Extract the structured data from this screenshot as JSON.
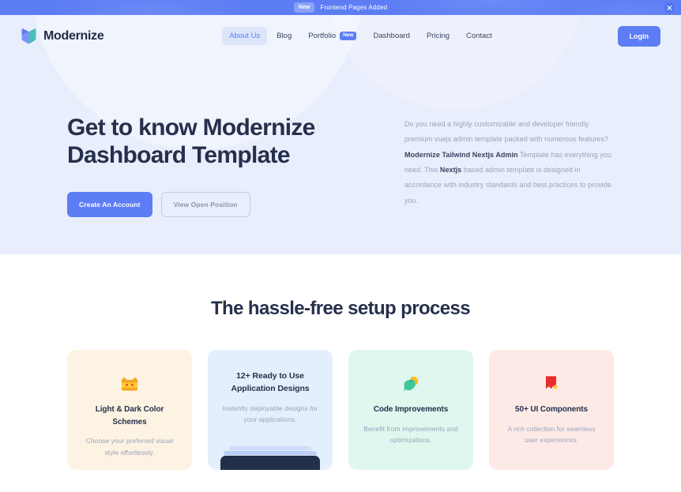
{
  "banner": {
    "badge": "New",
    "text": "Frontend Pages Added",
    "close_icon": "close-icon",
    "bg_color": "#5d7df5"
  },
  "navbar": {
    "brand": {
      "name": "Modernize",
      "logo_icon": "modernize-logo-icon"
    },
    "items": [
      {
        "label": "About Us",
        "active": true,
        "badge": null
      },
      {
        "label": "Blog",
        "active": false,
        "badge": null
      },
      {
        "label": "Portfolio",
        "active": false,
        "badge": "New"
      },
      {
        "label": "Dashboard",
        "active": false,
        "badge": null
      },
      {
        "label": "Pricing",
        "active": false,
        "badge": null
      },
      {
        "label": "Contact",
        "active": false,
        "badge": null
      }
    ],
    "login_label": "Login",
    "accent_color": "#5d7df5",
    "active_pill_color": "#dde5fb"
  },
  "hero": {
    "title_line1": "Get to know Modernize",
    "title_line2": "Dashboard Template",
    "primary_button": "Create An Account",
    "secondary_button": "View Open Position",
    "paragraph": {
      "part1": "Do you need a highly customizable and developer friendly premium vuejs admin template packed with numerous features? ",
      "bold1": "Modernize Tailwind Nextjs Admin",
      "part2": " Template has everything you need. This ",
      "bold2": "Nextjs",
      "part3": " based admin template is designed in accordance with industry standards and best practices to provide you."
    },
    "bg_color": "#e9eefc"
  },
  "features": {
    "heading": "The hassle-free setup process",
    "cards": [
      {
        "title": "Light & Dark Color Schemes",
        "desc": "Choose your preferred visual style effortlessly.",
        "icon": "color-palette-icon",
        "bg_color": "#fdf3e2",
        "variant": "icon-top"
      },
      {
        "title_line1": "12+ Ready to Use",
        "title_line2": "Application Designs",
        "title": "12+ Ready to Use Application Designs",
        "desc": "Instantly deployable designs for your applications.",
        "icon": "laptop-device-graphic",
        "bg_color": "#e4effd",
        "variant": "device-bottom"
      },
      {
        "title": "Code Improvements",
        "desc": "Benefit from improvements and optimizations.",
        "icon": "code-leaf-icon",
        "bg_color": "#dff7ee",
        "variant": "icon-top"
      },
      {
        "title": "50+ UI Components",
        "desc": "A rich collection for seamless user experiences.",
        "icon": "bookmark-star-icon",
        "bg_color": "#fdeae7",
        "variant": "icon-top"
      }
    ]
  }
}
